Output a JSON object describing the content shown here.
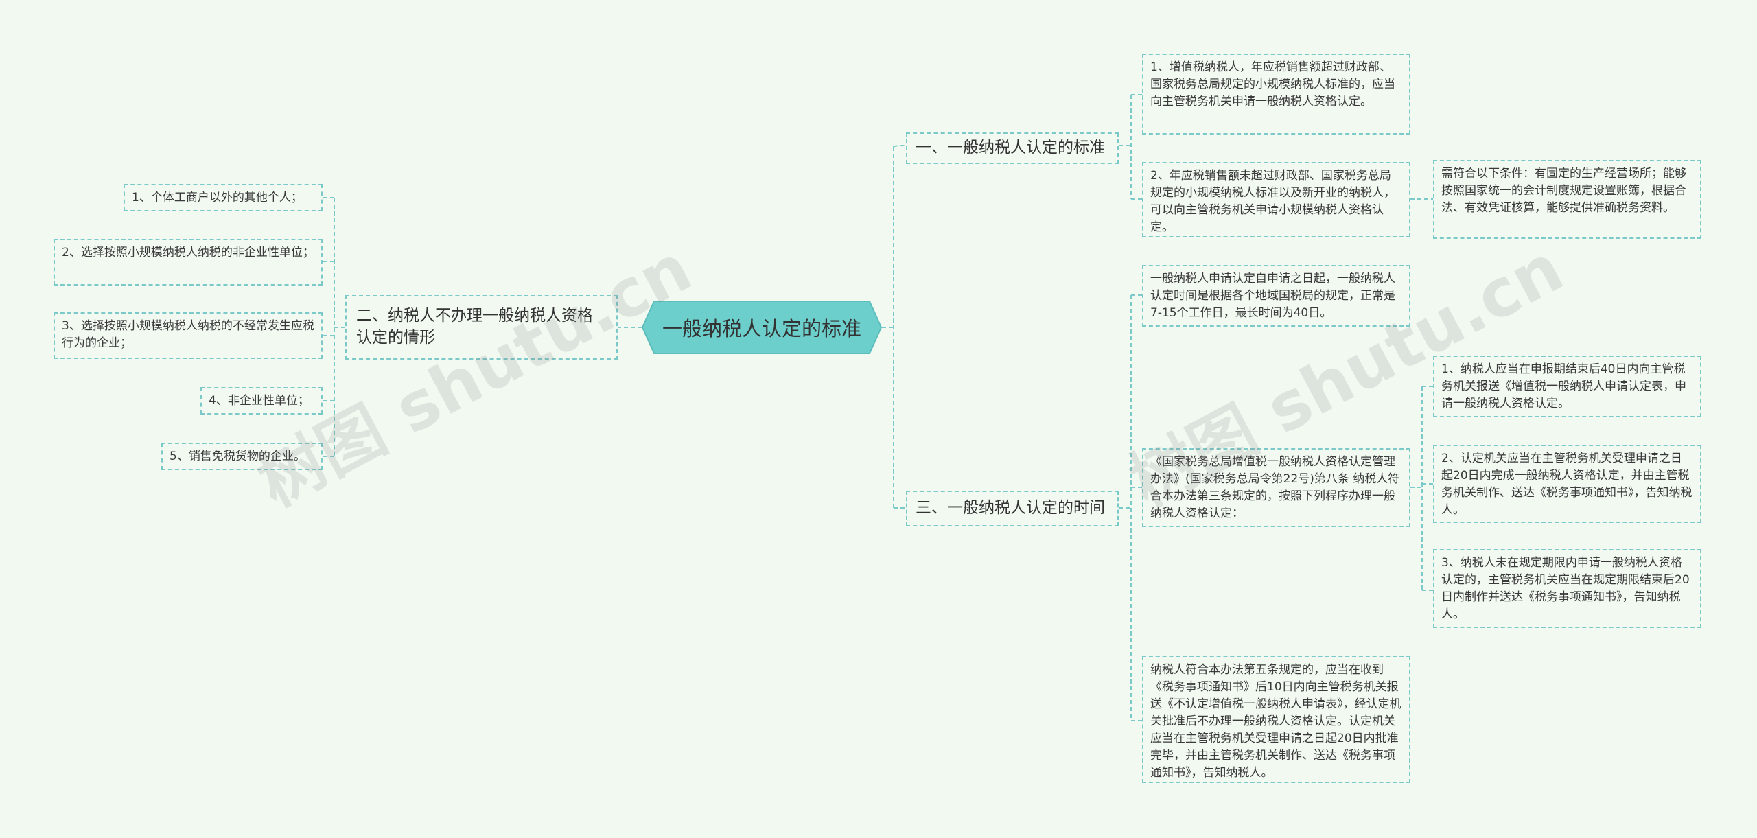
{
  "root": {
    "label": "一般纳税人认定的标准"
  },
  "branches": {
    "b1": {
      "label": "一、一般纳税人认定的标准"
    },
    "b2": {
      "label": "二、纳税人不办理一般纳税人资格认定的情形"
    },
    "b3": {
      "label": "三、一般纳税人认定的时间"
    }
  },
  "b1_children": {
    "c1": "1、增值税纳税人，年应税销售额超过财政部、国家税务总局规定的小规模纳税人标准的，应当向主管税务机关申请一般纳税人资格认定。",
    "c2": "2、年应税销售额未超过财政部、国家税务总局规定的小规模纳税人标准以及新开业的纳税人，可以向主管税务机关申请小规模纳税人资格认定。",
    "c2_child": "需符合以下条件：有固定的生产经营场所；能够按照国家统一的会计制度规定设置账簿，根据合法、有效凭证核算，能够提供准确税务资料。"
  },
  "b2_children": {
    "c1": "1、个体工商户以外的其他个人；",
    "c2": "2、选择按照小规模纳税人纳税的非企业性单位；",
    "c3": "3、选择按照小规模纳税人纳税的不经常发生应税行为的企业；",
    "c4": "4、非企业性单位；",
    "c5": "5、销售免税货物的企业。"
  },
  "b3_children": {
    "c1": "一般纳税人申请认定自申请之日起，一般纳税人认定时间是根据各个地域国税局的规定，正常是7-15个工作日，最长时间为40日。",
    "c2": "《国家税务总局增值税一般纳税人资格认定管理办法》(国家税务总局令第22号)第八条 纳税人符合本办法第三条规定的，按照下列程序办理一般纳税人资格认定：",
    "c2_children": {
      "g1": "1、纳税人应当在申报期结束后40日内向主管税务机关报送《增值税一般纳税人申请认定表，申请一般纳税人资格认定。",
      "g2": "2、认定机关应当在主管税务机关受理申请之日起20日内完成一般纳税人资格认定，并由主管税务机关制作、送达《税务事项通知书》，告知纳税人。",
      "g3": "3、纳税人未在规定期限内申请一般纳税人资格认定的，主管税务机关应当在规定期限结束后20日内制作并送达《税务事项通知书》，告知纳税人。"
    },
    "c3": "纳税人符合本办法第五条规定的，应当在收到《税务事项通知书》后10日内向主管税务机关报送《不认定增值税一般纳税人申请表》，经认定机关批准后不办理一般纳税人资格认定。认定机关应当在主管税务机关受理申请之日起20日内批准完毕，并由主管税务机关制作、送达《税务事项通知书》，告知纳税人。"
  },
  "watermarks": [
    "树图 shutu.cn",
    "树图 shutu.cn"
  ],
  "colors": {
    "background": "#f1f9f1",
    "root_fill": "#6dcfcc",
    "line": "#7cc9c9"
  }
}
